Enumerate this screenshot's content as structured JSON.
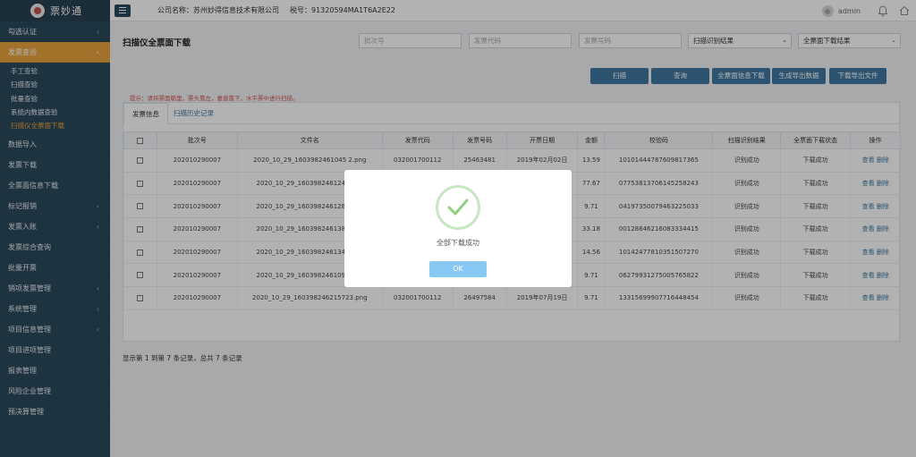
{
  "app": {
    "name": "票妙通"
  },
  "header": {
    "company": "公司名称：苏州妙得信息技术有限公司",
    "taxno": "税号：91320594MA1T6A2E22",
    "user": "admin"
  },
  "sidebar": {
    "items": [
      {
        "label": "勾选认证",
        "chevron": "‹"
      },
      {
        "label": "发票查验",
        "chevron": "‹",
        "active": true
      },
      {
        "label": "数据导入"
      },
      {
        "label": "发票下载"
      },
      {
        "label": "全票面信息下载"
      },
      {
        "label": "标记报销",
        "chevron": "‹"
      },
      {
        "label": "发票入账",
        "chevron": "‹"
      },
      {
        "label": "发票综合查询"
      },
      {
        "label": "批量开票"
      },
      {
        "label": "销项发票管理",
        "chevron": "‹"
      },
      {
        "label": "系统管理",
        "chevron": "‹"
      },
      {
        "label": "项目信息管理",
        "chevron": "‹"
      },
      {
        "label": "项目进项管理"
      },
      {
        "label": "报表管理"
      },
      {
        "label": "风险企业管理"
      },
      {
        "label": "预决算管理"
      }
    ],
    "subitems": [
      "手工查验",
      "扫描查验",
      "批量查验",
      "系统内数据查验",
      "扫描仪全票面下载"
    ]
  },
  "page": {
    "title": "扫描仪全票面下载",
    "filters": {
      "batch": "批次号",
      "invoice_code": "发票代码",
      "invoice_no": "发票号码",
      "scan_result": "扫描识别结果",
      "download_result": "全票面下载结果"
    },
    "buttons": [
      "扫描",
      "查询",
      "全票面信息下载",
      "生成导出数据",
      "下载导出文件"
    ],
    "hint": "提示：请将票面朝里，票头靠左，垂直靠下，水平票中进行扫描。",
    "tabs": [
      "发票信息",
      "扫描历史记录"
    ]
  },
  "table": {
    "columns": [
      "",
      "批次号",
      "文件名",
      "发票代码",
      "发票号码",
      "开票日期",
      "金额",
      "校验码",
      "扫描识别结果",
      "全票面下载状态",
      "操作"
    ],
    "rows": [
      [
        "202010290007",
        "2020_10_29_1603982461045 2.png",
        "032001700112",
        "25463481",
        "2019年02月02日",
        "13.59",
        "10101444787609817365",
        "识别成功",
        "下载成功"
      ],
      [
        "202010290007",
        "2020_10_29_160398246124770.p",
        "",
        "",
        "",
        "77.67",
        "07753813706145258243",
        "识别成功",
        "下载成功"
      ],
      [
        "202010290007",
        "2020_10_29_160398246128435.p",
        "",
        "",
        "",
        "9.71",
        "04197350079463225033",
        "识别成功",
        "下载成功"
      ],
      [
        "202010290007",
        "2020_10_29_160398246138223.p",
        "",
        "",
        "",
        "33.18",
        "00128846216083334415",
        "识别成功",
        "下载成功"
      ],
      [
        "202010290007",
        "2020_10_29_160398246134933.p",
        "",
        "",
        "",
        "14.56",
        "10142477810351507270",
        "识别成功",
        "下载成功"
      ],
      [
        "202010290007",
        "2020_10_29_160398246109325.p",
        "",
        "",
        "",
        "9.71",
        "06279931275005765822",
        "识别成功",
        "下载成功"
      ],
      [
        "202010290007",
        "2020_10_29_160398246215723.png",
        "032001700112",
        "26497584",
        "2019年07月19日",
        "9.71",
        "13315699907716448454",
        "识别成功",
        "下载成功"
      ]
    ],
    "op_view": "查看",
    "op_delete": "删除"
  },
  "pager": {
    "text": "显示第 1 到第 7 条记录，总共 7 条记录"
  },
  "modal": {
    "message": "全部下载成功",
    "ok": "OK"
  }
}
